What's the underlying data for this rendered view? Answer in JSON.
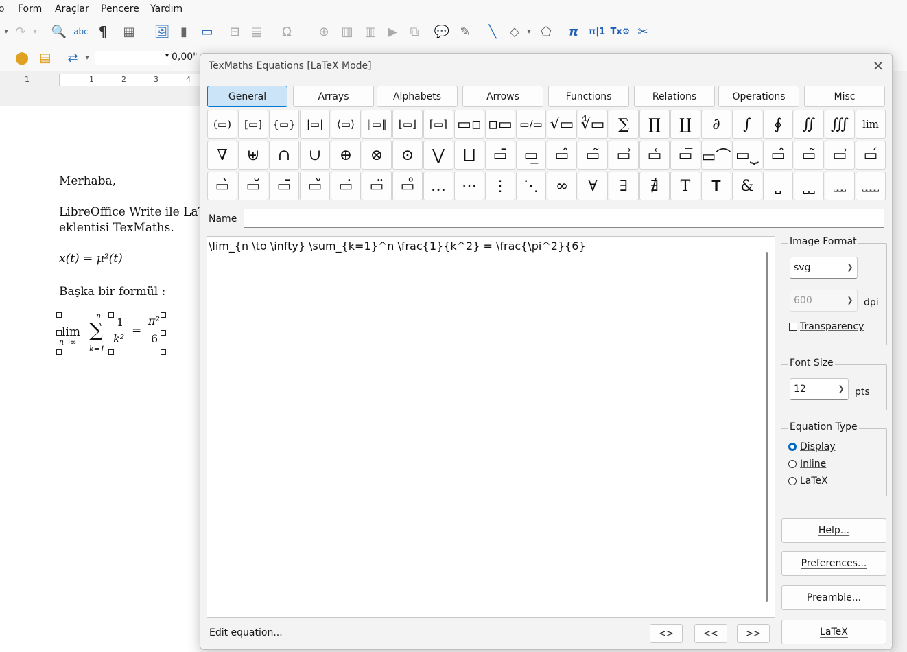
{
  "menubar": {
    "items": [
      "Form",
      "Araçlar",
      "Pencere",
      "Yardım"
    ]
  },
  "toolbar2": {
    "line_width_value": "0,00\""
  },
  "ruler": {
    "marks": [
      "1",
      "1",
      "2",
      "3",
      "4"
    ]
  },
  "document": {
    "greeting": "Merhaba,",
    "line1": "LibreOffice Write ile LaT",
    "line2": "eklentisi TexMaths.",
    "formula1": "x(t) = μ²(t)",
    "another_formula": "Başka bir formül  :",
    "formula2_lim": "lim",
    "formula2_sub": "n→∞",
    "formula2_sum": "∑",
    "formula2_top": "n",
    "formula2_bottom": "k=1",
    "formula2_num": "1",
    "formula2_den": "k²",
    "formula2_eq": "=",
    "formula2_pi": "π²",
    "formula2_six": "6"
  },
  "dialog": {
    "title": "TexMaths Equations [LaTeX Mode]",
    "tabs": [
      "General",
      "Arrays",
      "Alphabets",
      "Arrows",
      "Functions",
      "Relations",
      "Operations",
      "Misc"
    ],
    "active_tab": "General",
    "symbols_row1": [
      "(▭)",
      "[▭]",
      "{▭}",
      "|▭|",
      "⟨▭⟩",
      "‖▭‖",
      "⌊▭⌋",
      "⌈▭⌉",
      "▭▫",
      "▫▭",
      "▭/▭",
      "√▭",
      "∜▭",
      "∑",
      "∏",
      "∐",
      "∂",
      "∫",
      "∮",
      "∬",
      "∭",
      "lim"
    ],
    "symbols_row2": [
      "∇",
      "⊎",
      "∩",
      "∪",
      "⊕",
      "⊗",
      "⊙",
      "⋁",
      "⨆",
      "▭̄",
      "▭̲",
      "▭̂",
      "▭̃",
      "▭⃗",
      "▭⃖",
      "▭̅",
      "▭⌒",
      "▭⏟",
      "▭̂",
      "▭̃",
      "▭⃗",
      "▭́"
    ],
    "symbols_row3": [
      "▭̀",
      "▭̆",
      "▭̄",
      "▭̌",
      "▭̇",
      "▭̈",
      "▭̊",
      "…",
      "⋯",
      "⋮",
      "⋱",
      "∞",
      "∀",
      "∃",
      "∄",
      "T",
      "𝐓",
      "&",
      "⎵",
      "⎵⎵",
      "⎵⎵⎵",
      "⎵⎵⎵⎵"
    ],
    "name_label": "Name",
    "name_value": "",
    "equation": "\\lim_{n \\to \\infty} \\sum_{k=1}^n \\frac{1}{k^2} = \\frac{\\pi^2}{6}",
    "image_format": {
      "title": "Image Format",
      "format": "svg",
      "dpi_value": "600",
      "dpi_label": "dpi",
      "transparency_label": "Transparency"
    },
    "font_size": {
      "title": "Font Size",
      "value": "12",
      "unit": "pts"
    },
    "equation_type": {
      "title": "Equation Type",
      "options": [
        "Display",
        "Inline",
        "LaTeX"
      ],
      "selected": "Display"
    },
    "buttons": {
      "help": "Help...",
      "preferences": "Preferences...",
      "preamble": "Preamble...",
      "latex": "LaTeX"
    },
    "status": "Edit equation...",
    "nav": {
      "toggle": "<>",
      "prev": "<<",
      "next": ">>"
    }
  }
}
